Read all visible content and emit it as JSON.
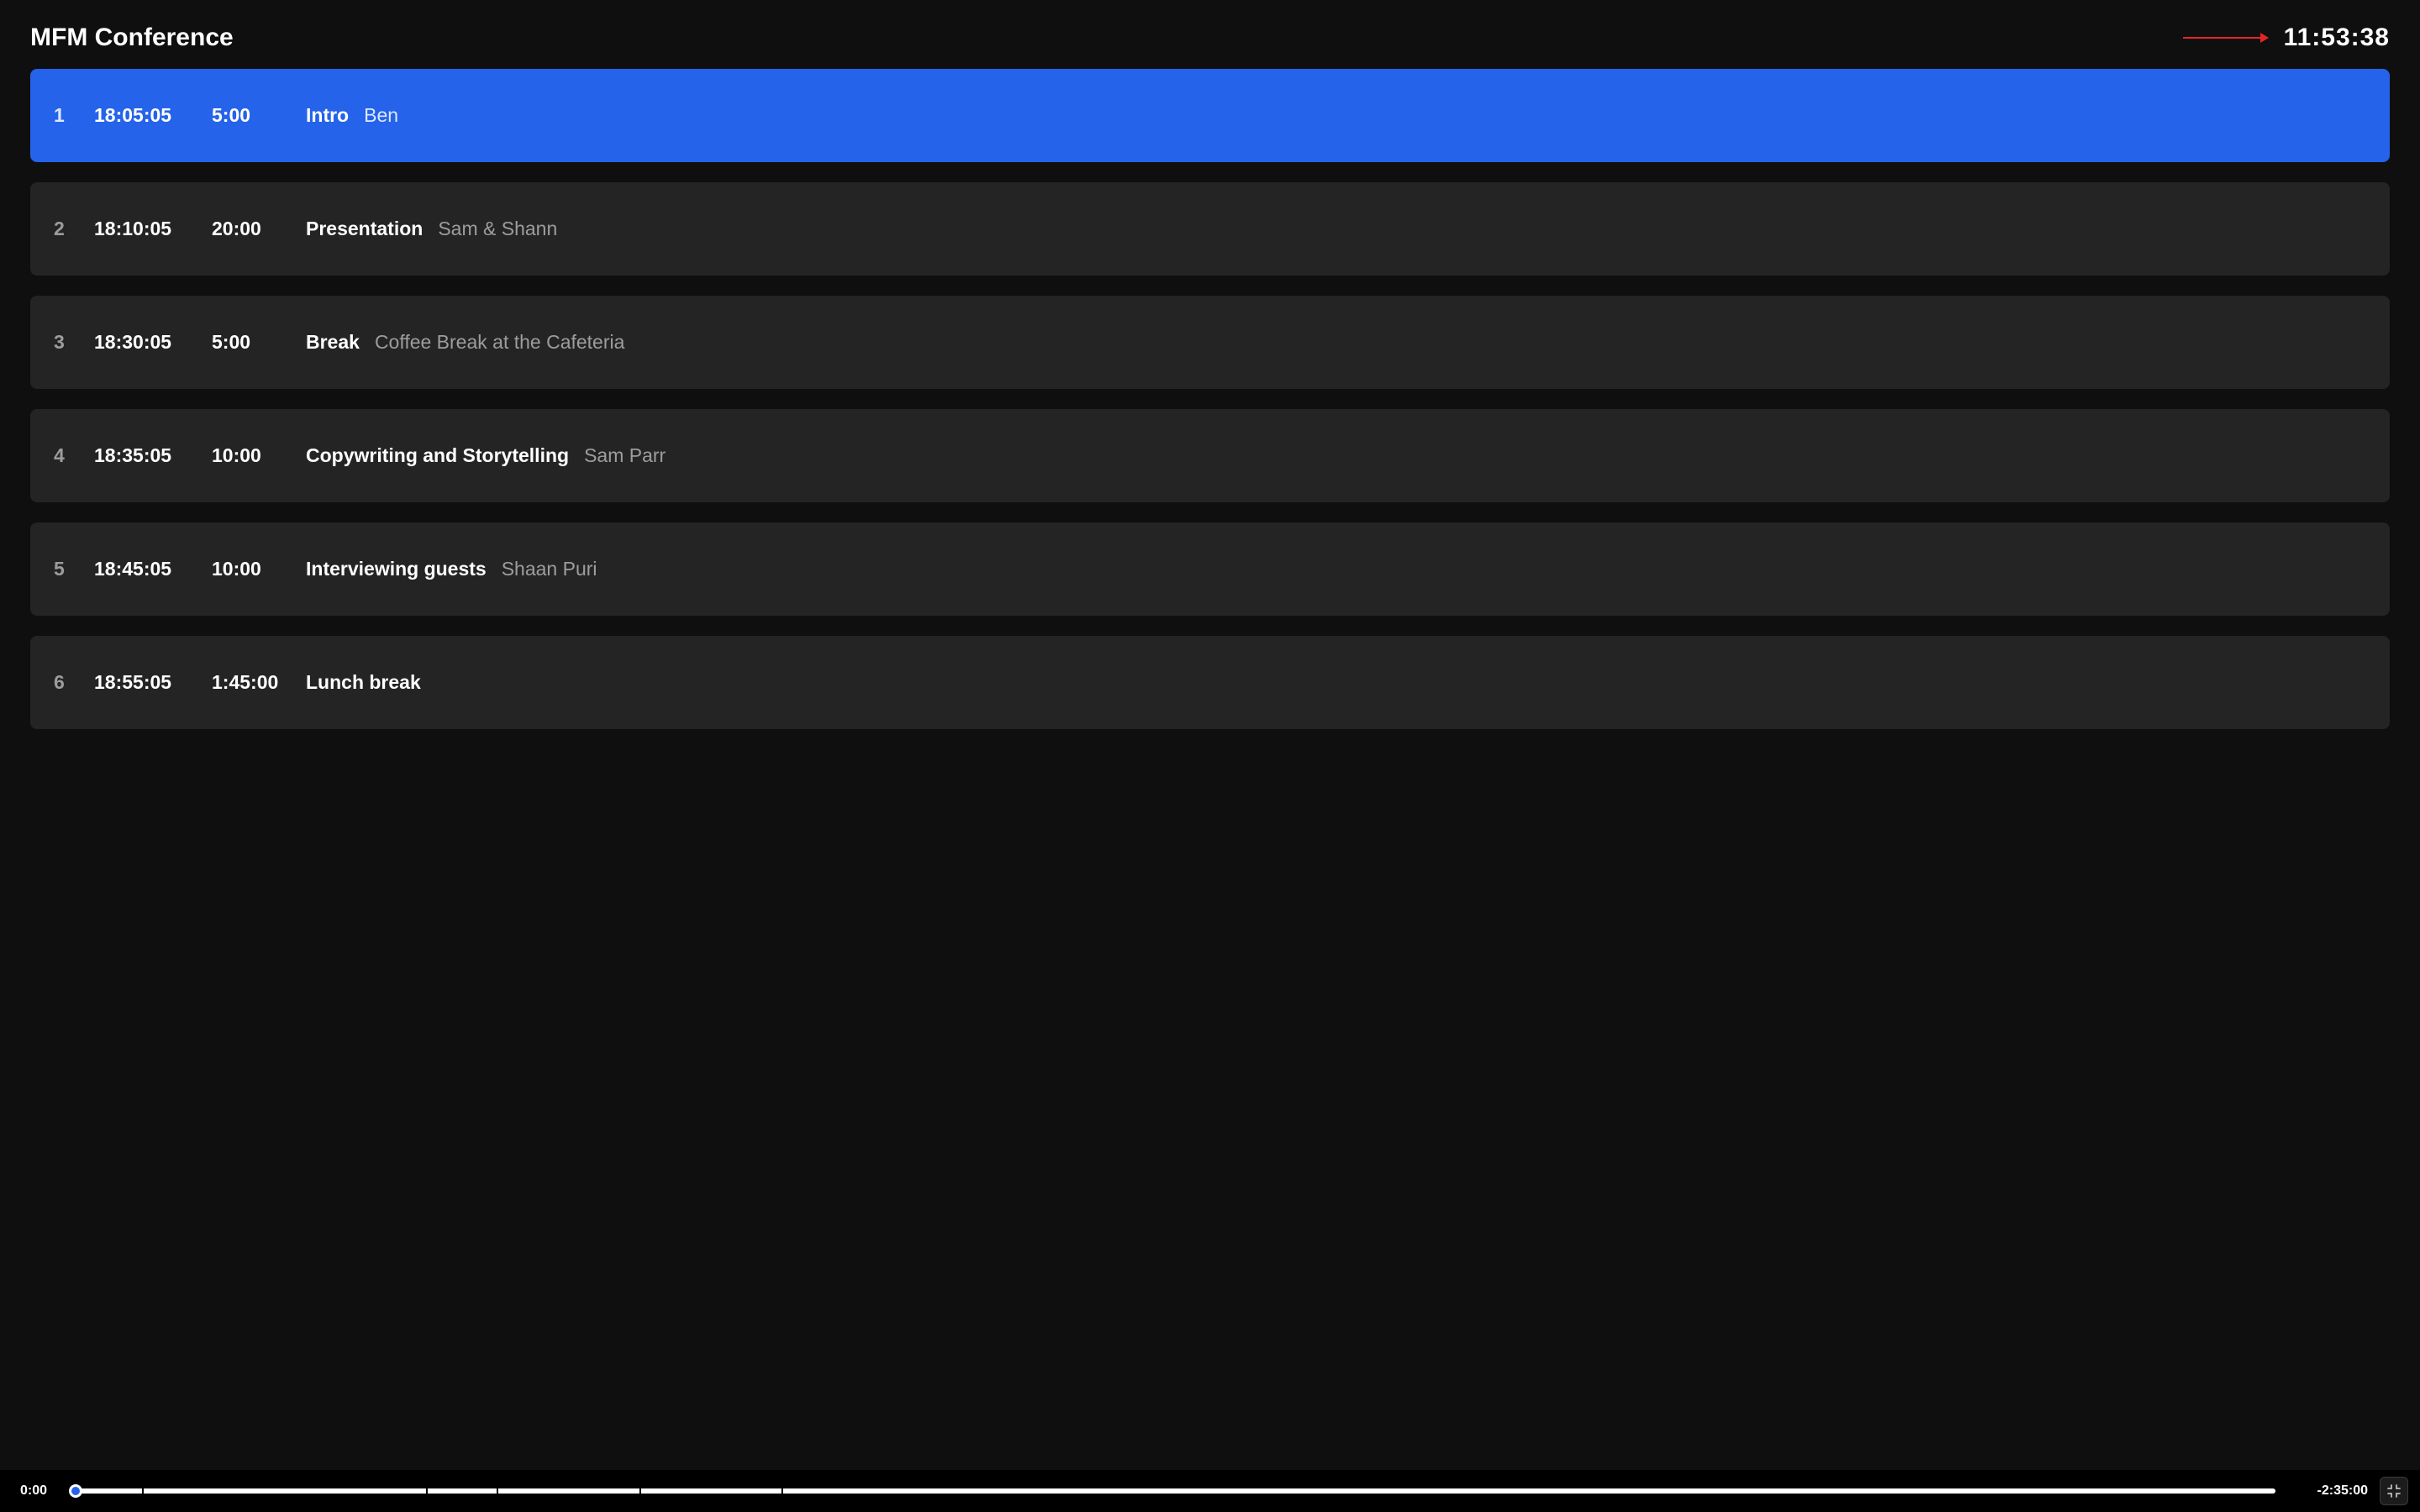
{
  "header": {
    "title": "MFM Conference",
    "clock": "11:53:38"
  },
  "segments": [
    {
      "index": "1",
      "start": "18:05:05",
      "duration": "5:00",
      "title": "Intro",
      "subtitle": "Ben",
      "active": true
    },
    {
      "index": "2",
      "start": "18:10:05",
      "duration": "20:00",
      "title": "Presentation",
      "subtitle": "Sam & Shann",
      "active": false
    },
    {
      "index": "3",
      "start": "18:30:05",
      "duration": "5:00",
      "title": "Break",
      "subtitle": "Coffee Break at the Cafeteria",
      "active": false
    },
    {
      "index": "4",
      "start": "18:35:05",
      "duration": "10:00",
      "title": "Copywriting and Storytelling",
      "subtitle": "Sam Parr",
      "active": false
    },
    {
      "index": "5",
      "start": "18:45:05",
      "duration": "10:00",
      "title": "Interviewing guests",
      "subtitle": "Shaan Puri",
      "active": false
    },
    {
      "index": "6",
      "start": "18:55:05",
      "duration": "1:45:00",
      "title": "Lunch break",
      "subtitle": "",
      "active": false
    }
  ],
  "timeline": {
    "elapsed": "0:00",
    "remaining": "-2:35:00",
    "segment_minutes": [
      5,
      20,
      5,
      10,
      10,
      105
    ],
    "total_minutes": 155
  }
}
